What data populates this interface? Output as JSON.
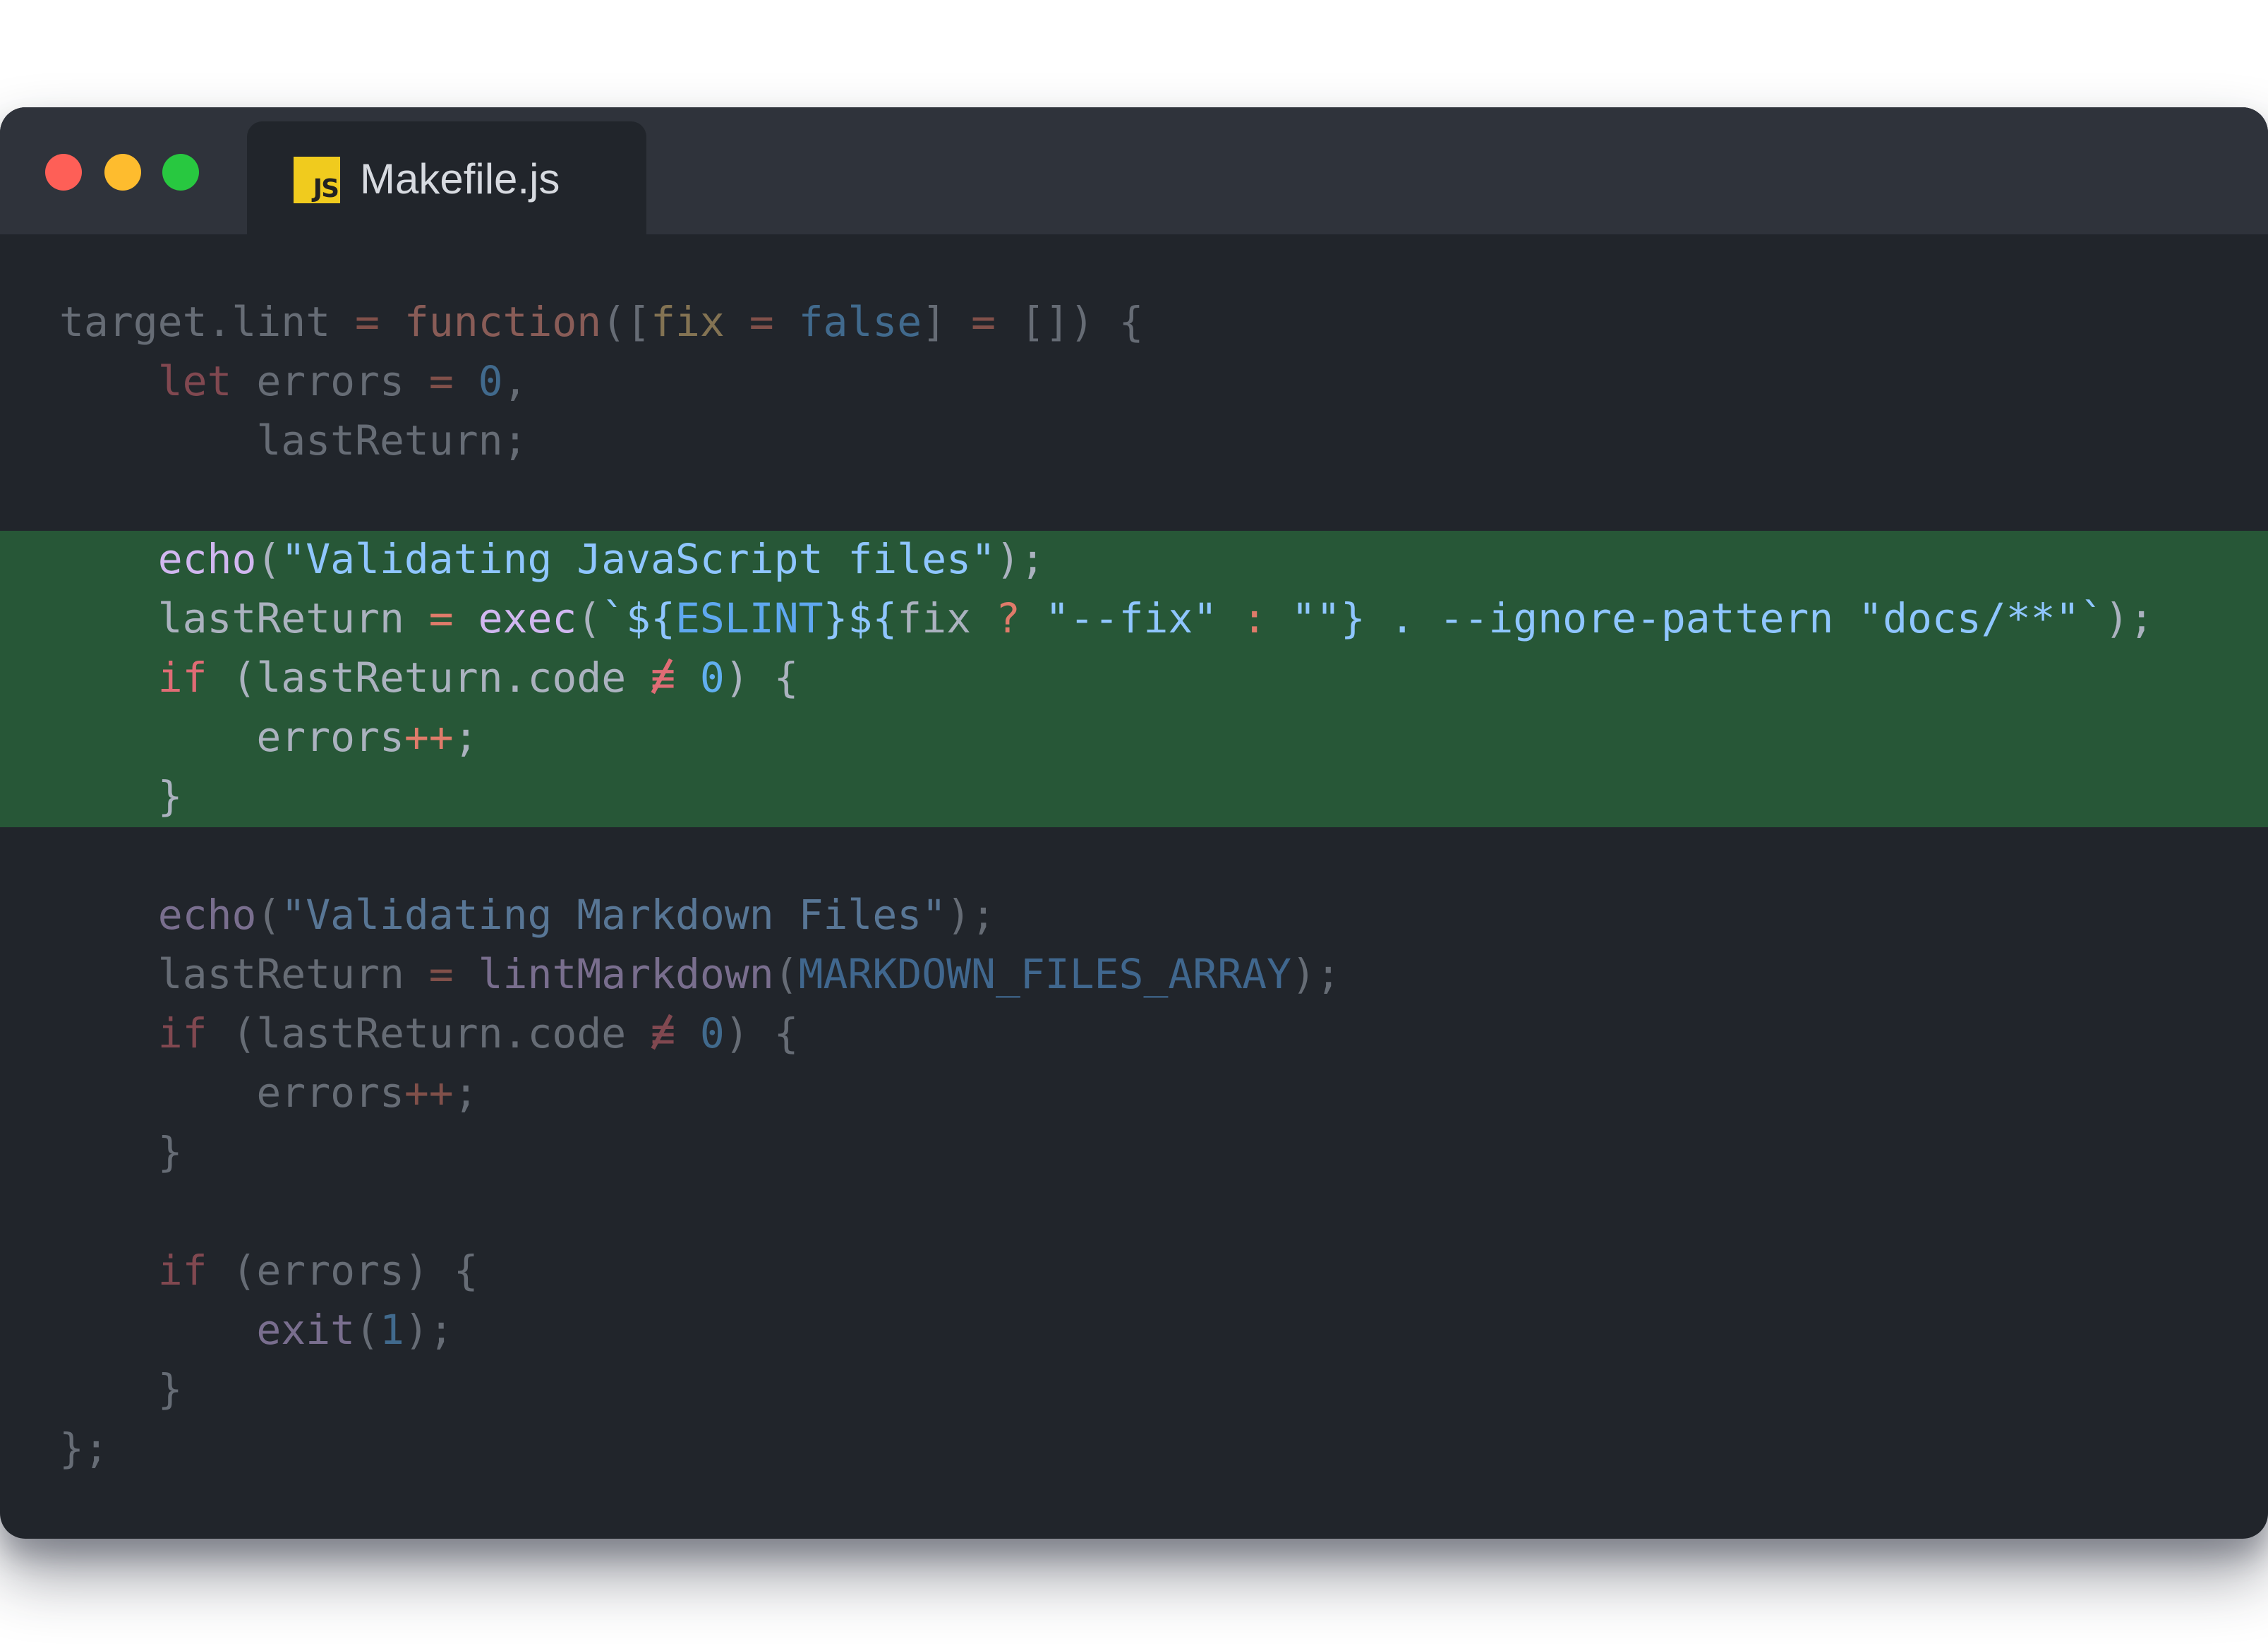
{
  "tab": {
    "filename": "Makefile.js",
    "language_badge": "JS",
    "icon": "javascript-file-icon"
  },
  "window_controls": [
    "close",
    "minimize",
    "maximize"
  ],
  "colors": {
    "close": "#fe5f57",
    "minimize": "#febc2e",
    "maximize": "#28c840",
    "editor_background": "#21252b",
    "highlight_background": "#275737",
    "js_badge": "#f0cb1e"
  },
  "highlighted_lines": [
    5,
    6,
    7,
    8,
    9
  ],
  "code": {
    "lines": [
      [
        {
          "t": "target.lint "
        },
        {
          "t": "=",
          "c": "o"
        },
        {
          "t": " "
        },
        {
          "t": "function",
          "c": "f"
        },
        {
          "t": "(["
        },
        {
          "t": "fix",
          "c": "v"
        },
        {
          "t": " "
        },
        {
          "t": "=",
          "c": "o"
        },
        {
          "t": " "
        },
        {
          "t": "false",
          "c": "n"
        },
        {
          "t": "] "
        },
        {
          "t": "=",
          "c": "o"
        },
        {
          "t": " []) {"
        }
      ],
      [
        {
          "t": "    "
        },
        {
          "t": "let",
          "c": "k"
        },
        {
          "t": " errors "
        },
        {
          "t": "=",
          "c": "o"
        },
        {
          "t": " "
        },
        {
          "t": "0",
          "c": "n"
        },
        {
          "t": ","
        }
      ],
      [
        {
          "t": "        lastReturn;"
        }
      ],
      [],
      [
        {
          "t": "    "
        },
        {
          "t": "echo",
          "c": "b"
        },
        {
          "t": "("
        },
        {
          "t": "\"Validating JavaScript files\"",
          "c": "s"
        },
        {
          "t": ");"
        }
      ],
      [
        {
          "t": "    lastReturn "
        },
        {
          "t": "=",
          "c": "o"
        },
        {
          "t": " "
        },
        {
          "t": "exec",
          "c": "b"
        },
        {
          "t": "("
        },
        {
          "t": "`${",
          "c": "s"
        },
        {
          "t": "ESLINT",
          "c": "c"
        },
        {
          "t": "}${",
          "c": "s"
        },
        {
          "t": "fix "
        },
        {
          "t": "?",
          "c": "o"
        },
        {
          "t": " "
        },
        {
          "t": "\"--fix\"",
          "c": "s"
        },
        {
          "t": " "
        },
        {
          "t": ":",
          "c": "o"
        },
        {
          "t": " "
        },
        {
          "t": "\"\"",
          "c": "s"
        },
        {
          "t": "}",
          "c": "s"
        },
        {
          "t": " . --ignore-pattern \"docs/**\"`",
          "c": "s"
        },
        {
          "t": ");"
        }
      ],
      [
        {
          "t": "    "
        },
        {
          "t": "if",
          "c": "k"
        },
        {
          "t": " (lastReturn.code "
        },
        {
          "t": "≡",
          "c": "ne"
        },
        {
          "t": " "
        },
        {
          "t": "0",
          "c": "n"
        },
        {
          "t": ") {"
        }
      ],
      [
        {
          "t": "        errors"
        },
        {
          "t": "++",
          "c": "o"
        },
        {
          "t": ";"
        }
      ],
      [
        {
          "t": "    }"
        }
      ],
      [],
      [
        {
          "t": "    "
        },
        {
          "t": "echo",
          "c": "b"
        },
        {
          "t": "("
        },
        {
          "t": "\"Validating Markdown Files\"",
          "c": "s"
        },
        {
          "t": ");"
        }
      ],
      [
        {
          "t": "    lastReturn "
        },
        {
          "t": "=",
          "c": "o"
        },
        {
          "t": " "
        },
        {
          "t": "lintMarkdown",
          "c": "b"
        },
        {
          "t": "("
        },
        {
          "t": "MARKDOWN_FILES_ARRAY",
          "c": "c"
        },
        {
          "t": ");"
        }
      ],
      [
        {
          "t": "    "
        },
        {
          "t": "if",
          "c": "k"
        },
        {
          "t": " (lastReturn.code "
        },
        {
          "t": "≡",
          "c": "ne"
        },
        {
          "t": " "
        },
        {
          "t": "0",
          "c": "n"
        },
        {
          "t": ") {"
        }
      ],
      [
        {
          "t": "        errors"
        },
        {
          "t": "++",
          "c": "o"
        },
        {
          "t": ";"
        }
      ],
      [
        {
          "t": "    }"
        }
      ],
      [],
      [
        {
          "t": "    "
        },
        {
          "t": "if",
          "c": "k"
        },
        {
          "t": " (errors) {"
        }
      ],
      [
        {
          "t": "        "
        },
        {
          "t": "exit",
          "c": "b"
        },
        {
          "t": "("
        },
        {
          "t": "1",
          "c": "n"
        },
        {
          "t": ");"
        }
      ],
      [
        {
          "t": "    }"
        }
      ],
      [
        {
          "t": "};"
        }
      ]
    ]
  }
}
